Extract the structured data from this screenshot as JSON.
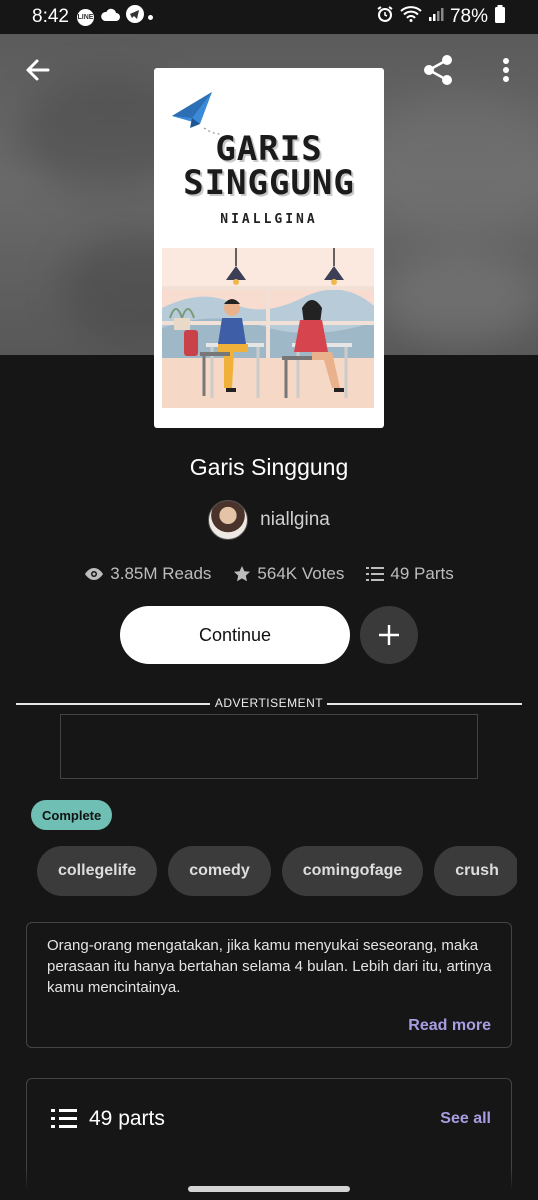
{
  "status_bar": {
    "time": "8:42",
    "notif_icons": [
      "line-app-icon",
      "cloud-icon",
      "telegram-icon"
    ],
    "battery": "78%"
  },
  "cover": {
    "title_line1": "GARIS",
    "title_line2": "SINGGUNG",
    "author": "NIALLGINA"
  },
  "book": {
    "title": "Garis Singgung",
    "author": "niallgina"
  },
  "stats": {
    "reads": "3.85M Reads",
    "votes": "564K Votes",
    "parts": "49 Parts"
  },
  "actions": {
    "continue_label": "Continue"
  },
  "ad": {
    "label": "ADVERTISEMENT"
  },
  "status_badge": "Complete",
  "tags": [
    "collegelife",
    "comedy",
    "comingofage",
    "crush"
  ],
  "description": {
    "text": "Orang-orang mengatakan, jika kamu menyukai seseorang, maka perasaan itu hanya bertahan selama 4 bulan. Lebih dari itu, artinya kamu mencintainya.",
    "read_more": "Read more"
  },
  "parts_section": {
    "label": "49 parts",
    "see_all": "See all"
  },
  "colors": {
    "accent": "#a99de2",
    "complete_badge": "#6fbfb4",
    "background": "#161616"
  }
}
